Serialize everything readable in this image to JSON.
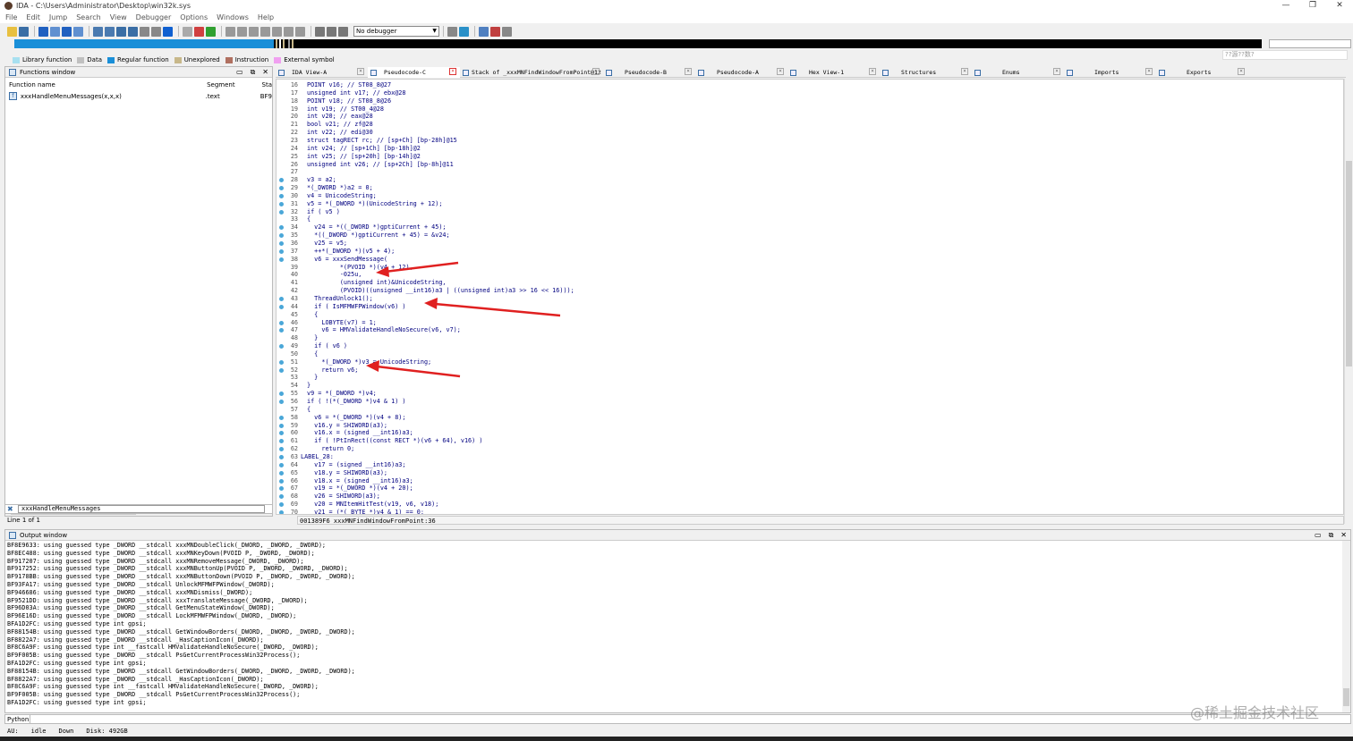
{
  "window": {
    "title": "IDA - C:\\Users\\Administrator\\Desktop\\win32k.sys",
    "minimize": "—",
    "maximize": "❐",
    "close": "✕"
  },
  "menu": [
    "File",
    "Edit",
    "Jump",
    "Search",
    "View",
    "Debugger",
    "Options",
    "Windows",
    "Help"
  ],
  "toolbar": {
    "debugger_select": "No debugger"
  },
  "tooltip": "??源??数?",
  "legend": [
    {
      "label": "Library function",
      "color": "#a8e0f0"
    },
    {
      "label": "Data",
      "color": "#c0c0c0"
    },
    {
      "label": "Regular function",
      "color": "#1a8fd8"
    },
    {
      "label": "Unexplored",
      "color": "#c8b88a"
    },
    {
      "label": "Instruction",
      "color": "#b07060"
    },
    {
      "label": "External symbol",
      "color": "#f0a0f0"
    }
  ],
  "functions_window": {
    "title": "Functions window",
    "columns": [
      "Function name",
      "Segment",
      "Sta"
    ],
    "rows": [
      {
        "name": "xxxHandleMenuMessages(x,x,x)",
        "segment": ".text",
        "start": "BF9"
      }
    ],
    "filter": "xxxHandleMenuMessages",
    "line_info": "Line 1 of 1"
  },
  "tabs": [
    {
      "label": "IDA View-A",
      "active": false
    },
    {
      "label": "Pseudocode-C",
      "active": true
    },
    {
      "label": "Stack of _xxxMNFindWindowFromPoint@12",
      "active": false
    },
    {
      "label": "Pseudocode-B",
      "active": false
    },
    {
      "label": "Pseudocode-A",
      "active": false
    },
    {
      "label": "Hex View-1",
      "active": false
    },
    {
      "label": "Structures",
      "active": false
    },
    {
      "label": "Enums",
      "active": false
    },
    {
      "label": "Imports",
      "active": false
    },
    {
      "label": "Exports",
      "active": false
    }
  ],
  "code_lines": [
    {
      "n": "16",
      "t": "POINT v16; // ST08_8@27",
      "dot": false
    },
    {
      "n": "17",
      "t": "unsigned int v17; // ebx@28",
      "dot": false
    },
    {
      "n": "18",
      "t": "POINT v18; // ST08_8@26",
      "dot": false
    },
    {
      "n": "19",
      "t": "int v19; // ST00_4@28",
      "dot": false
    },
    {
      "n": "20",
      "t": "int v20; // eax@28",
      "dot": false
    },
    {
      "n": "21",
      "t": "bool v21; // zf@28",
      "dot": false
    },
    {
      "n": "22",
      "t": "int v22; // edi@30",
      "dot": false
    },
    {
      "n": "23",
      "t": "struct tagRECT rc; // [sp+Ch] [bp-28h]@15",
      "dot": false
    },
    {
      "n": "24",
      "t": "int v24; // [sp+1Ch] [bp-18h]@2",
      "dot": false
    },
    {
      "n": "25",
      "t": "int v25; // [sp+20h] [bp-14h]@2",
      "dot": false
    },
    {
      "n": "26",
      "t": "unsigned int v26; // [sp+2Ch] [bp-8h]@11",
      "dot": false
    },
    {
      "n": "27",
      "t": "",
      "dot": false
    },
    {
      "n": "28",
      "t": "v3 = a2;",
      "dot": true
    },
    {
      "n": "29",
      "t": "*(_DWORD *)a2 = 0;",
      "dot": true
    },
    {
      "n": "30",
      "t": "v4 = UnicodeString;",
      "dot": true
    },
    {
      "n": "31",
      "t": "v5 = *(_DWORD *)(UnicodeString + 12);",
      "dot": true
    },
    {
      "n": "32",
      "t": "if ( v5 )",
      "dot": true
    },
    {
      "n": "33",
      "t": "{",
      "dot": false
    },
    {
      "n": "34",
      "t": "  v24 = *((_DWORD *)gptiCurrent + 45);",
      "dot": true
    },
    {
      "n": "35",
      "t": "  *((_DWORD *)gptiCurrent + 45) = &v24;",
      "dot": true
    },
    {
      "n": "36",
      "t": "  v25 = v5;",
      "dot": true
    },
    {
      "n": "37",
      "t": "  ++*(_DWORD *)(v5 + 4);",
      "dot": true
    },
    {
      "n": "38",
      "t": "  v6 = xxxSendMessage(",
      "dot": true
    },
    {
      "n": "39",
      "t": "         *(PVOID *)(v4 + 12),",
      "dot": false
    },
    {
      "n": "40",
      "t": "         -025u,",
      "dot": false
    },
    {
      "n": "41",
      "t": "         (unsigned int)&UnicodeString,",
      "dot": false
    },
    {
      "n": "42",
      "t": "         (PVOID)((unsigned __int16)a3 | ((unsigned int)a3 >> 16 << 16)));",
      "dot": false
    },
    {
      "n": "43",
      "t": "  ThreadUnlock1();",
      "dot": true
    },
    {
      "n": "44",
      "t": "  if ( IsMFMWFPWindow(v6) )",
      "dot": true
    },
    {
      "n": "45",
      "t": "  {",
      "dot": false
    },
    {
      "n": "46",
      "t": "    LOBYTE(v7) = 1;",
      "dot": true
    },
    {
      "n": "47",
      "t": "    v6 = HMValidateHandleNoSecure(v6, v7);",
      "dot": true
    },
    {
      "n": "48",
      "t": "  }",
      "dot": false
    },
    {
      "n": "49",
      "t": "  if ( v6 )",
      "dot": true
    },
    {
      "n": "50",
      "t": "  {",
      "dot": false
    },
    {
      "n": "51",
      "t": "    *(_DWORD *)v3 = UnicodeString;",
      "dot": true
    },
    {
      "n": "52",
      "t": "    return v6;",
      "dot": true
    },
    {
      "n": "53",
      "t": "  }",
      "dot": false
    },
    {
      "n": "54",
      "t": "}",
      "dot": false
    },
    {
      "n": "55",
      "t": "v9 = *(_DWORD *)v4;",
      "dot": true
    },
    {
      "n": "56",
      "t": "if ( !(*(_DWORD *)v4 & 1) )",
      "dot": true
    },
    {
      "n": "57",
      "t": "{",
      "dot": false
    },
    {
      "n": "58",
      "t": "  v6 = *(_DWORD *)(v4 + 8);",
      "dot": true
    },
    {
      "n": "59",
      "t": "  v16.y = SHIWORD(a3);",
      "dot": true
    },
    {
      "n": "60",
      "t": "  v16.x = (signed __int16)a3;",
      "dot": true
    },
    {
      "n": "61",
      "t": "  if ( !PtInRect((const RECT *)(v6 + 64), v16) )",
      "dot": true
    },
    {
      "n": "62",
      "t": "    return 0;",
      "dot": true
    },
    {
      "n": "63",
      "t": "LABEL_28:",
      "dot": true,
      "label": true
    },
    {
      "n": "64",
      "t": "  v17 = (signed __int16)a3;",
      "dot": true
    },
    {
      "n": "65",
      "t": "  v18.y = SHIWORD(a3);",
      "dot": true
    },
    {
      "n": "66",
      "t": "  v18.x = (signed __int16)a3;",
      "dot": true
    },
    {
      "n": "67",
      "t": "  v19 = *(_DWORD *)(v4 + 20);",
      "dot": true
    },
    {
      "n": "68",
      "t": "  v26 = SHIWORD(a3);",
      "dot": true
    },
    {
      "n": "69",
      "t": "  v20 = MNItemHitTest(v19, v6, v18);",
      "dot": true
    },
    {
      "n": "70",
      "t": "  v21 = (*(_BYTE *)v4 & 1) == 0;",
      "dot": true
    }
  ],
  "code_status": "001389F6 xxxMNFindWindowFromPoint:36",
  "output_window": {
    "title": "Output window",
    "lines": [
      "BF8E9633: using guessed type _DWORD __stdcall xxxMNDoubleClick(_DWORD, _DWORD, _DWORD);",
      "BF8EC488: using guessed type _DWORD __stdcall xxxMNKeyDown(PVOID P, _DWORD, _DWORD);",
      "BF917207: using guessed type _DWORD __stdcall xxxMNRemoveMessage(_DWORD, _DWORD);",
      "BF917252: using guessed type _DWORD __stdcall xxxMNButtonUp(PVOID P, _DWORD, _DWORD, _DWORD);",
      "BF9178BB: using guessed type _DWORD __stdcall xxxMNButtonDown(PVOID P, _DWORD, _DWORD, _DWORD);",
      "BF93FA17: using guessed type _DWORD __stdcall UnlockMFMWFPWindow(_DWORD);",
      "BF946686: using guessed type _DWORD __stdcall xxxMNDismiss(_DWORD);",
      "BF9521DD: using guessed type _DWORD __stdcall xxxTranslateMessage(_DWORD, _DWORD);",
      "BF96D03A: using guessed type _DWORD __stdcall GetMenuStateWindow(_DWORD);",
      "BF96E16D: using guessed type _DWORD __stdcall LockMFMWFPWindow(_DWORD, _DWORD);",
      "BFA1D2FC: using guessed type int gpsi;",
      "BF88154B: using guessed type _DWORD __stdcall GetWindowBorders(_DWORD, _DWORD, _DWORD, _DWORD);",
      "BF8822A7: using guessed type _DWORD __stdcall _HasCaptionIcon(_DWORD);",
      "BF8C6A9F: using guessed type int __fastcall HMValidateHandleNoSecure(_DWORD, _DWORD);",
      "BF9F005B: using guessed type _DWORD __stdcall PsGetCurrentProcessWin32Process();",
      "BFA1D2FC: using guessed type int gpsi;",
      "BF88154B: using guessed type _DWORD __stdcall GetWindowBorders(_DWORD, _DWORD, _DWORD, _DWORD);",
      "BF8822A7: using guessed type _DWORD __stdcall _HasCaptionIcon(_DWORD);",
      "BF8C6A9F: using guessed type int __fastcall HMValidateHandleNoSecure(_DWORD, _DWORD);",
      "BF9F005B: using guessed type _DWORD __stdcall PsGetCurrentProcessWin32Process();",
      "BFA1D2FC: using guessed type int gpsi;"
    ]
  },
  "python_label": "Python",
  "status": {
    "au": "AU:",
    "state": "idle",
    "direction": "Down",
    "disk": "Disk: 492GB"
  },
  "watermark": "@稀土掘金技术社区",
  "colors": {
    "arrow": "#e02020",
    "nav_blue": "#1a8fd8",
    "code_blue": "#000080",
    "comment_gray": "#808080",
    "gutter_dot": "#4aa7d8"
  }
}
